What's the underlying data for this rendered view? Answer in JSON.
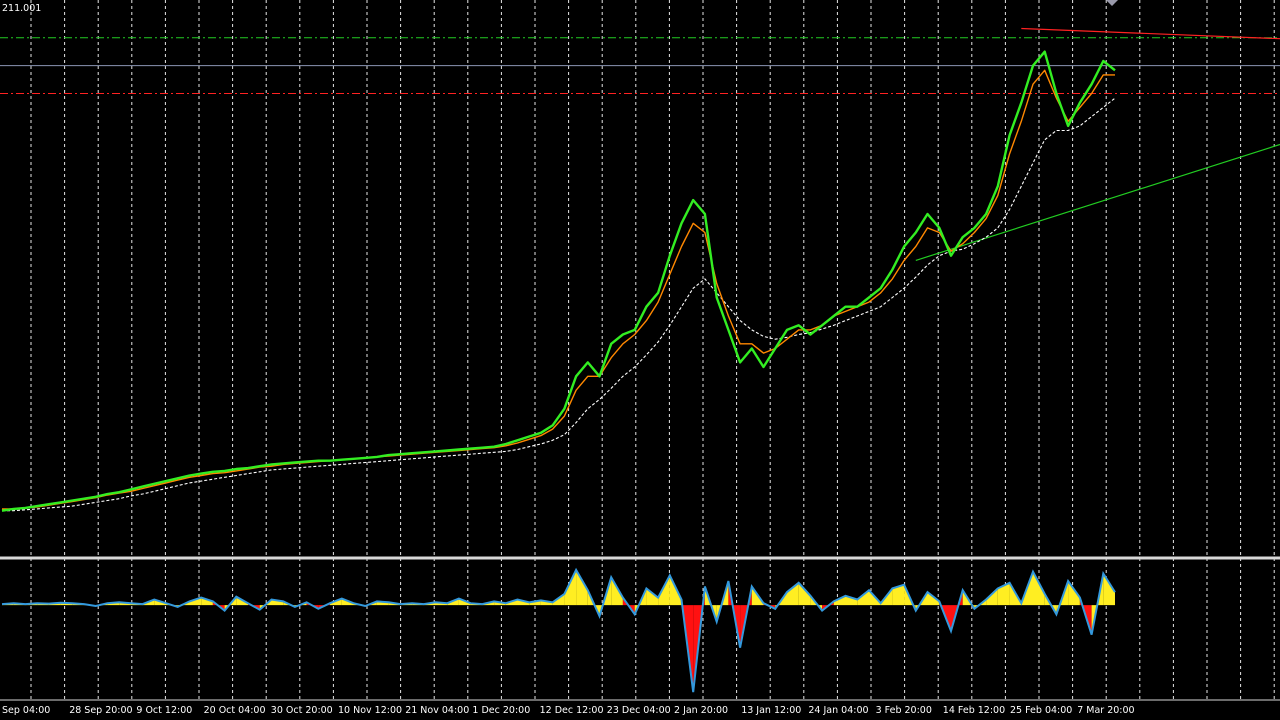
{
  "chart_data": {
    "type": "line",
    "price_label": "211.001",
    "x_labels": [
      "Sep 04:00",
      "28 Sep 20:00",
      "9 Oct 12:00",
      "20 Oct 04:00",
      "30 Oct 20:00",
      "10 Nov 12:00",
      "21 Nov 04:00",
      "1 Dec 20:00",
      "12 Dec 12:00",
      "23 Dec 04:00",
      "2 Jan 20:00",
      "13 Jan 12:00",
      "24 Jan 04:00",
      "3 Feb 20:00",
      "14 Feb 12:00",
      "25 Feb 04:00",
      "7 Mar 20:00"
    ],
    "series": [
      {
        "values": [
          0.1,
          0.12,
          0.13,
          0.15,
          0.17,
          0.19,
          0.21,
          0.23,
          0.25,
          0.28,
          0.3,
          0.33,
          0.36,
          0.39,
          0.42,
          0.45,
          0.48,
          0.5,
          0.52,
          0.53,
          0.55,
          0.56,
          0.58,
          0.6,
          0.61,
          0.62,
          0.63,
          0.64,
          0.64,
          0.65,
          0.66,
          0.67,
          0.68,
          0.7,
          0.71,
          0.72,
          0.73,
          0.74,
          0.75,
          0.76,
          0.77,
          0.78,
          0.79,
          0.82,
          0.86,
          0.9,
          0.94,
          1.02,
          1.2,
          1.55,
          1.7,
          1.55,
          1.9,
          2.0,
          2.05,
          2.3,
          2.45,
          2.85,
          3.2,
          3.45,
          3.3,
          2.4,
          2.05,
          1.7,
          1.85,
          1.65,
          1.85,
          2.05,
          2.1,
          2.0,
          2.1,
          2.2,
          2.3,
          2.3,
          2.4,
          2.5,
          2.7,
          2.95,
          3.1,
          3.3,
          3.15,
          2.85,
          3.05,
          3.15,
          3.3,
          3.6,
          4.15,
          4.5,
          4.9,
          5.05,
          4.6,
          4.25,
          4.5,
          4.7,
          4.95,
          4.85
        ],
        "color": "#33ee22"
      },
      {
        "values": [
          0.12,
          0.12,
          0.13,
          0.14,
          0.16,
          0.18,
          0.2,
          0.22,
          0.24,
          0.27,
          0.29,
          0.31,
          0.34,
          0.37,
          0.4,
          0.43,
          0.46,
          0.48,
          0.5,
          0.51,
          0.53,
          0.55,
          0.57,
          0.58,
          0.6,
          0.61,
          0.62,
          0.63,
          0.64,
          0.65,
          0.66,
          0.67,
          0.68,
          0.69,
          0.7,
          0.71,
          0.72,
          0.73,
          0.74,
          0.75,
          0.76,
          0.77,
          0.78,
          0.8,
          0.83,
          0.87,
          0.91,
          0.98,
          1.12,
          1.4,
          1.55,
          1.55,
          1.75,
          1.9,
          2.0,
          2.15,
          2.35,
          2.65,
          2.95,
          3.2,
          3.1,
          2.55,
          2.2,
          1.9,
          1.9,
          1.8,
          1.85,
          1.95,
          2.05,
          2.05,
          2.1,
          2.2,
          2.25,
          2.3,
          2.35,
          2.45,
          2.6,
          2.8,
          2.95,
          3.15,
          3.1,
          2.9,
          2.98,
          3.1,
          3.25,
          3.5,
          3.95,
          4.3,
          4.7,
          4.85,
          4.55,
          4.3,
          4.45,
          4.6,
          4.8,
          4.8
        ],
        "color": "#ff8800"
      },
      {
        "values": [
          0.1,
          0.1,
          0.11,
          0.12,
          0.13,
          0.14,
          0.15,
          0.17,
          0.19,
          0.21,
          0.23,
          0.26,
          0.28,
          0.31,
          0.34,
          0.37,
          0.4,
          0.42,
          0.44,
          0.46,
          0.48,
          0.5,
          0.52,
          0.54,
          0.55,
          0.56,
          0.57,
          0.58,
          0.59,
          0.6,
          0.61,
          0.62,
          0.63,
          0.64,
          0.65,
          0.66,
          0.67,
          0.68,
          0.69,
          0.7,
          0.71,
          0.72,
          0.73,
          0.74,
          0.76,
          0.79,
          0.82,
          0.86,
          0.92,
          1.05,
          1.2,
          1.3,
          1.42,
          1.55,
          1.65,
          1.78,
          1.92,
          2.1,
          2.3,
          2.5,
          2.6,
          2.45,
          2.3,
          2.15,
          2.05,
          1.98,
          1.95,
          1.97,
          2.0,
          2.02,
          2.06,
          2.1,
          2.15,
          2.2,
          2.25,
          2.3,
          2.4,
          2.5,
          2.62,
          2.75,
          2.85,
          2.9,
          2.92,
          2.98,
          3.05,
          3.15,
          3.35,
          3.6,
          3.85,
          4.1,
          4.2,
          4.2,
          4.25,
          4.35,
          4.45,
          4.55
        ],
        "color": "#ffffff",
        "dashed": true
      }
    ],
    "sub_values": [
      0.05,
      0.1,
      0.05,
      0.1,
      0.08,
      0.12,
      0.1,
      0.05,
      -0.05,
      0.1,
      0.15,
      0.1,
      0.05,
      0.3,
      0.1,
      -0.1,
      0.2,
      0.4,
      0.2,
      -0.3,
      0.45,
      0.1,
      -0.25,
      0.3,
      0.2,
      -0.1,
      0.15,
      -0.2,
      0.1,
      0.35,
      0.1,
      -0.05,
      0.2,
      0.15,
      0.05,
      0.1,
      0.05,
      0.15,
      0.1,
      0.35,
      0.1,
      0.05,
      0.2,
      0.1,
      0.3,
      0.15,
      0.25,
      0.15,
      0.6,
      1.9,
      0.8,
      -0.6,
      1.5,
      0.4,
      -0.5,
      0.9,
      0.4,
      1.6,
      0.3,
      -4.7,
      1.0,
      -0.9,
      1.3,
      -2.3,
      1.0,
      0.1,
      -0.2,
      0.7,
      1.2,
      0.5,
      -0.3,
      0.2,
      0.5,
      0.3,
      0.8,
      0.1,
      0.9,
      1.1,
      -0.3,
      0.7,
      0.2,
      -1.4,
      0.8,
      -0.2,
      0.3,
      0.9,
      1.2,
      0.1,
      1.8,
      0.6,
      -0.5,
      1.3,
      0.4,
      -1.6,
      1.7,
      0.7
    ],
    "hlines": [
      {
        "value": 5.2,
        "color": "#22cc22",
        "style": "dashdot"
      },
      {
        "value": 4.9,
        "color": "#8c96b4",
        "style": "solid"
      },
      {
        "value": 4.6,
        "color": "#ff2222",
        "style": "dashdot"
      }
    ],
    "trendlines": [
      {
        "from": [
          1.0,
          5.3
        ],
        "to": [
          1.0,
          5.19
        ],
        "start_index": 87,
        "color": "#ff2222"
      },
      {
        "from": [
          0,
          2.8
        ],
        "to": [
          0,
          4.05
        ],
        "start_index": 78,
        "color": "#22cc22"
      }
    ],
    "ylim": [
      0,
      5.5
    ],
    "sub_ylim": [
      -4.8,
      2.0
    ],
    "grid": true,
    "colors": {
      "background": "#000000",
      "grid": "#ffffff",
      "sub_positive": "#ffee22",
      "sub_negative": "#ff1111",
      "sub_line": "#3399dd"
    }
  }
}
